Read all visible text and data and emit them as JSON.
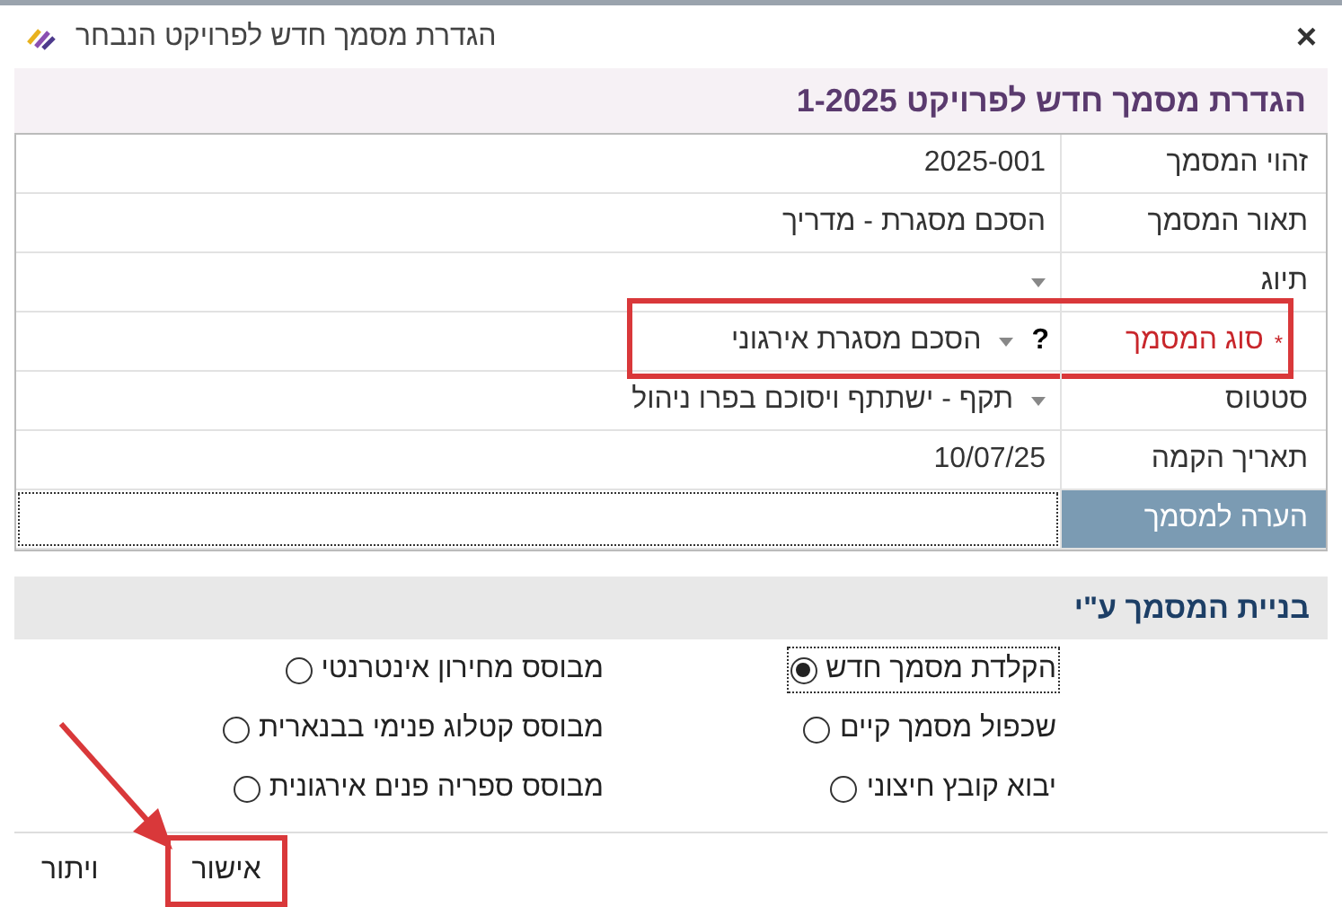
{
  "window": {
    "title": "הגדרת מסמך חדש לפרויקט הנבחר",
    "close": "×"
  },
  "header": {
    "title": "הגדרת מסמך חדש לפרויקט 1-2025"
  },
  "fields": [
    {
      "kind": "text",
      "label": "זהוי המסמך",
      "value": "2025-001"
    },
    {
      "kind": "text",
      "label": "תאור המסמך",
      "value": "הסכם מסגרת - מדריך"
    },
    {
      "kind": "dropdown",
      "label": "תיוג"
    },
    {
      "kind": "dropdown",
      "label": "סוג המסמך",
      "value": "הסכם מסגרת אירגוני",
      "required": true,
      "marker": "*",
      "help": "?",
      "highlighted": true
    },
    {
      "kind": "dropdown",
      "label": "סטטוס",
      "value": "תקף - ישתתף ויסוכם בפרו ניהול"
    },
    {
      "kind": "text",
      "label": "תאריך הקמה",
      "value": "10/07/25"
    },
    {
      "kind": "note",
      "label": "הערה למסמך",
      "focused": true
    }
  ],
  "section": {
    "title": "בניית המסמך ע\"י",
    "options": [
      {
        "label": "הקלדת מסמך חדש",
        "selected": true,
        "focused": true
      },
      {
        "label": "מבוסס מחירון אינטרנטי",
        "selected": false,
        "focused": false
      },
      {
        "label": "שכפול מסמך קיים",
        "selected": false,
        "focused": false
      },
      {
        "label": "מבוסס קטלוג פנימי בבנארית",
        "selected": false,
        "focused": false
      },
      {
        "label": "יבוא קובץ חיצוני",
        "selected": false,
        "focused": false
      },
      {
        "label": "מבוסס ספריה פנים אירגונית",
        "selected": false,
        "focused": false
      }
    ]
  },
  "buttons": [
    {
      "label": "אישור",
      "highlighted": true
    },
    {
      "label": "ויתור",
      "highlighted": false
    }
  ]
}
